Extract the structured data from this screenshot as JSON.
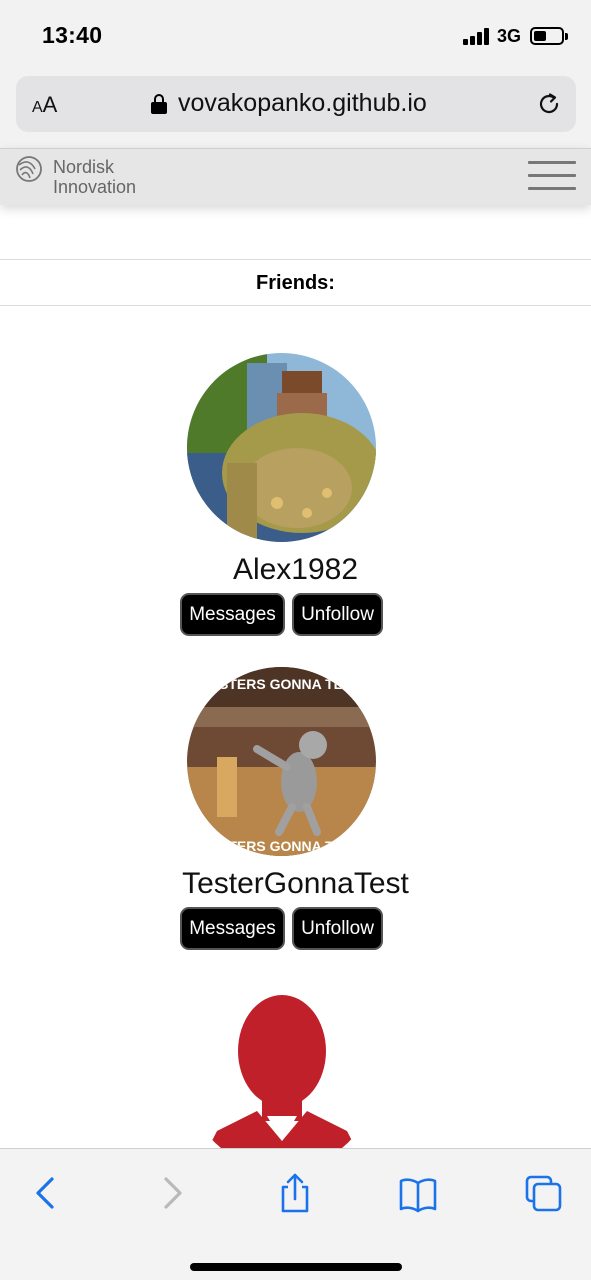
{
  "status_bar": {
    "time": "13:40",
    "network": "3G",
    "signal_icon": "cellular-signal-icon",
    "battery_level": 0.45
  },
  "browser": {
    "text_size_label": "AA",
    "url": "vovakopanko.github.io",
    "lock_icon": "lock-icon",
    "reload_icon": "reload-icon"
  },
  "site_header": {
    "logo_line1": "Nordisk",
    "logo_line2": "Innovation",
    "menu_icon": "hamburger-menu-icon"
  },
  "friends": {
    "title": "Friends:",
    "items": [
      {
        "name": "Alex1982",
        "messages_label": "Messages",
        "unfollow_label": "Unfollow"
      },
      {
        "name": "TesterGonnaTest",
        "messages_label": "Messages",
        "unfollow_label": "Unfollow",
        "avatar_text_top": "TESTERS GONNA TEST",
        "avatar_text_bottom": "TESTERS GONNA TEST"
      },
      {
        "name": "",
        "avatar": "default-user-silhouette"
      }
    ]
  },
  "toolbar": {
    "icons": [
      "back-icon",
      "forward-icon",
      "share-icon",
      "bookmarks-icon",
      "tabs-icon"
    ]
  },
  "colors": {
    "accent": "#1a73e8",
    "button_bg": "#000000",
    "button_text": "#ffffff",
    "header_bg": "#e6e6e6",
    "silhouette_red": "#c0202a"
  }
}
